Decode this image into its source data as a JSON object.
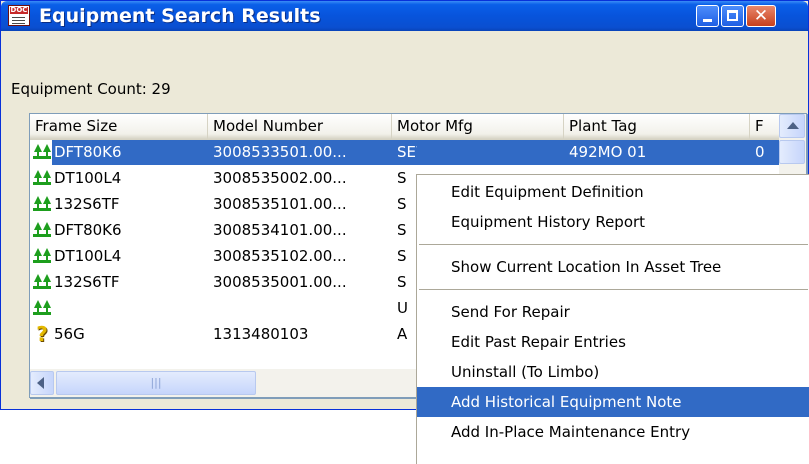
{
  "window": {
    "title": "Equipment Search Results",
    "icon": "doc-icon",
    "buttons": [
      "minimize",
      "maximize",
      "close"
    ]
  },
  "equipment_count_label": "Equipment Count: 29",
  "table": {
    "columns": [
      "Frame Size",
      "Model Number",
      "Motor Mfg",
      "Plant Tag",
      "F"
    ],
    "rows": [
      {
        "icon": "install-icon",
        "frame": "DFT80K6",
        "model": "3008533501.00...",
        "mfg": "SEW Eurodrive",
        "tag": "492MO 01",
        "f": "0",
        "selected": true
      },
      {
        "icon": "install-icon",
        "frame": "DT100L4",
        "model": "3008535002.00...",
        "mfg": "S",
        "tag": "",
        "f": ""
      },
      {
        "icon": "install-icon",
        "frame": "132S6TF",
        "model": "3008535101.00...",
        "mfg": "S",
        "tag": "",
        "f": ""
      },
      {
        "icon": "install-icon",
        "frame": "DFT80K6",
        "model": "3008534101.00...",
        "mfg": "S",
        "tag": "",
        "f": ""
      },
      {
        "icon": "install-icon",
        "frame": "DT100L4",
        "model": "3008535102.00...",
        "mfg": "S",
        "tag": "",
        "f": ""
      },
      {
        "icon": "install-icon",
        "frame": "132S6TF",
        "model": "3008535001.00...",
        "mfg": "S",
        "tag": "",
        "f": ""
      },
      {
        "icon": "install-icon",
        "frame": "",
        "model": "",
        "mfg": "U",
        "tag": "",
        "f": ""
      },
      {
        "icon": "question-icon",
        "frame": "56G",
        "model": "1313480103",
        "mfg": "A",
        "tag": "",
        "f": ""
      }
    ]
  },
  "context_menu": {
    "groups": [
      [
        "Edit Equipment Definition",
        "Equipment History Report"
      ],
      [
        "Show Current Location In Asset Tree"
      ],
      [
        "Send For Repair",
        "Edit Past Repair Entries",
        "Uninstall (To Limbo)",
        "Add Historical Equipment Note",
        "Add In-Place Maintenance Entry"
      ]
    ],
    "highlighted": "Add Historical Equipment Note"
  },
  "colors": {
    "titlebar": "#0754dc",
    "selection": "#316ac5",
    "window_bg": "#ece9d8"
  }
}
